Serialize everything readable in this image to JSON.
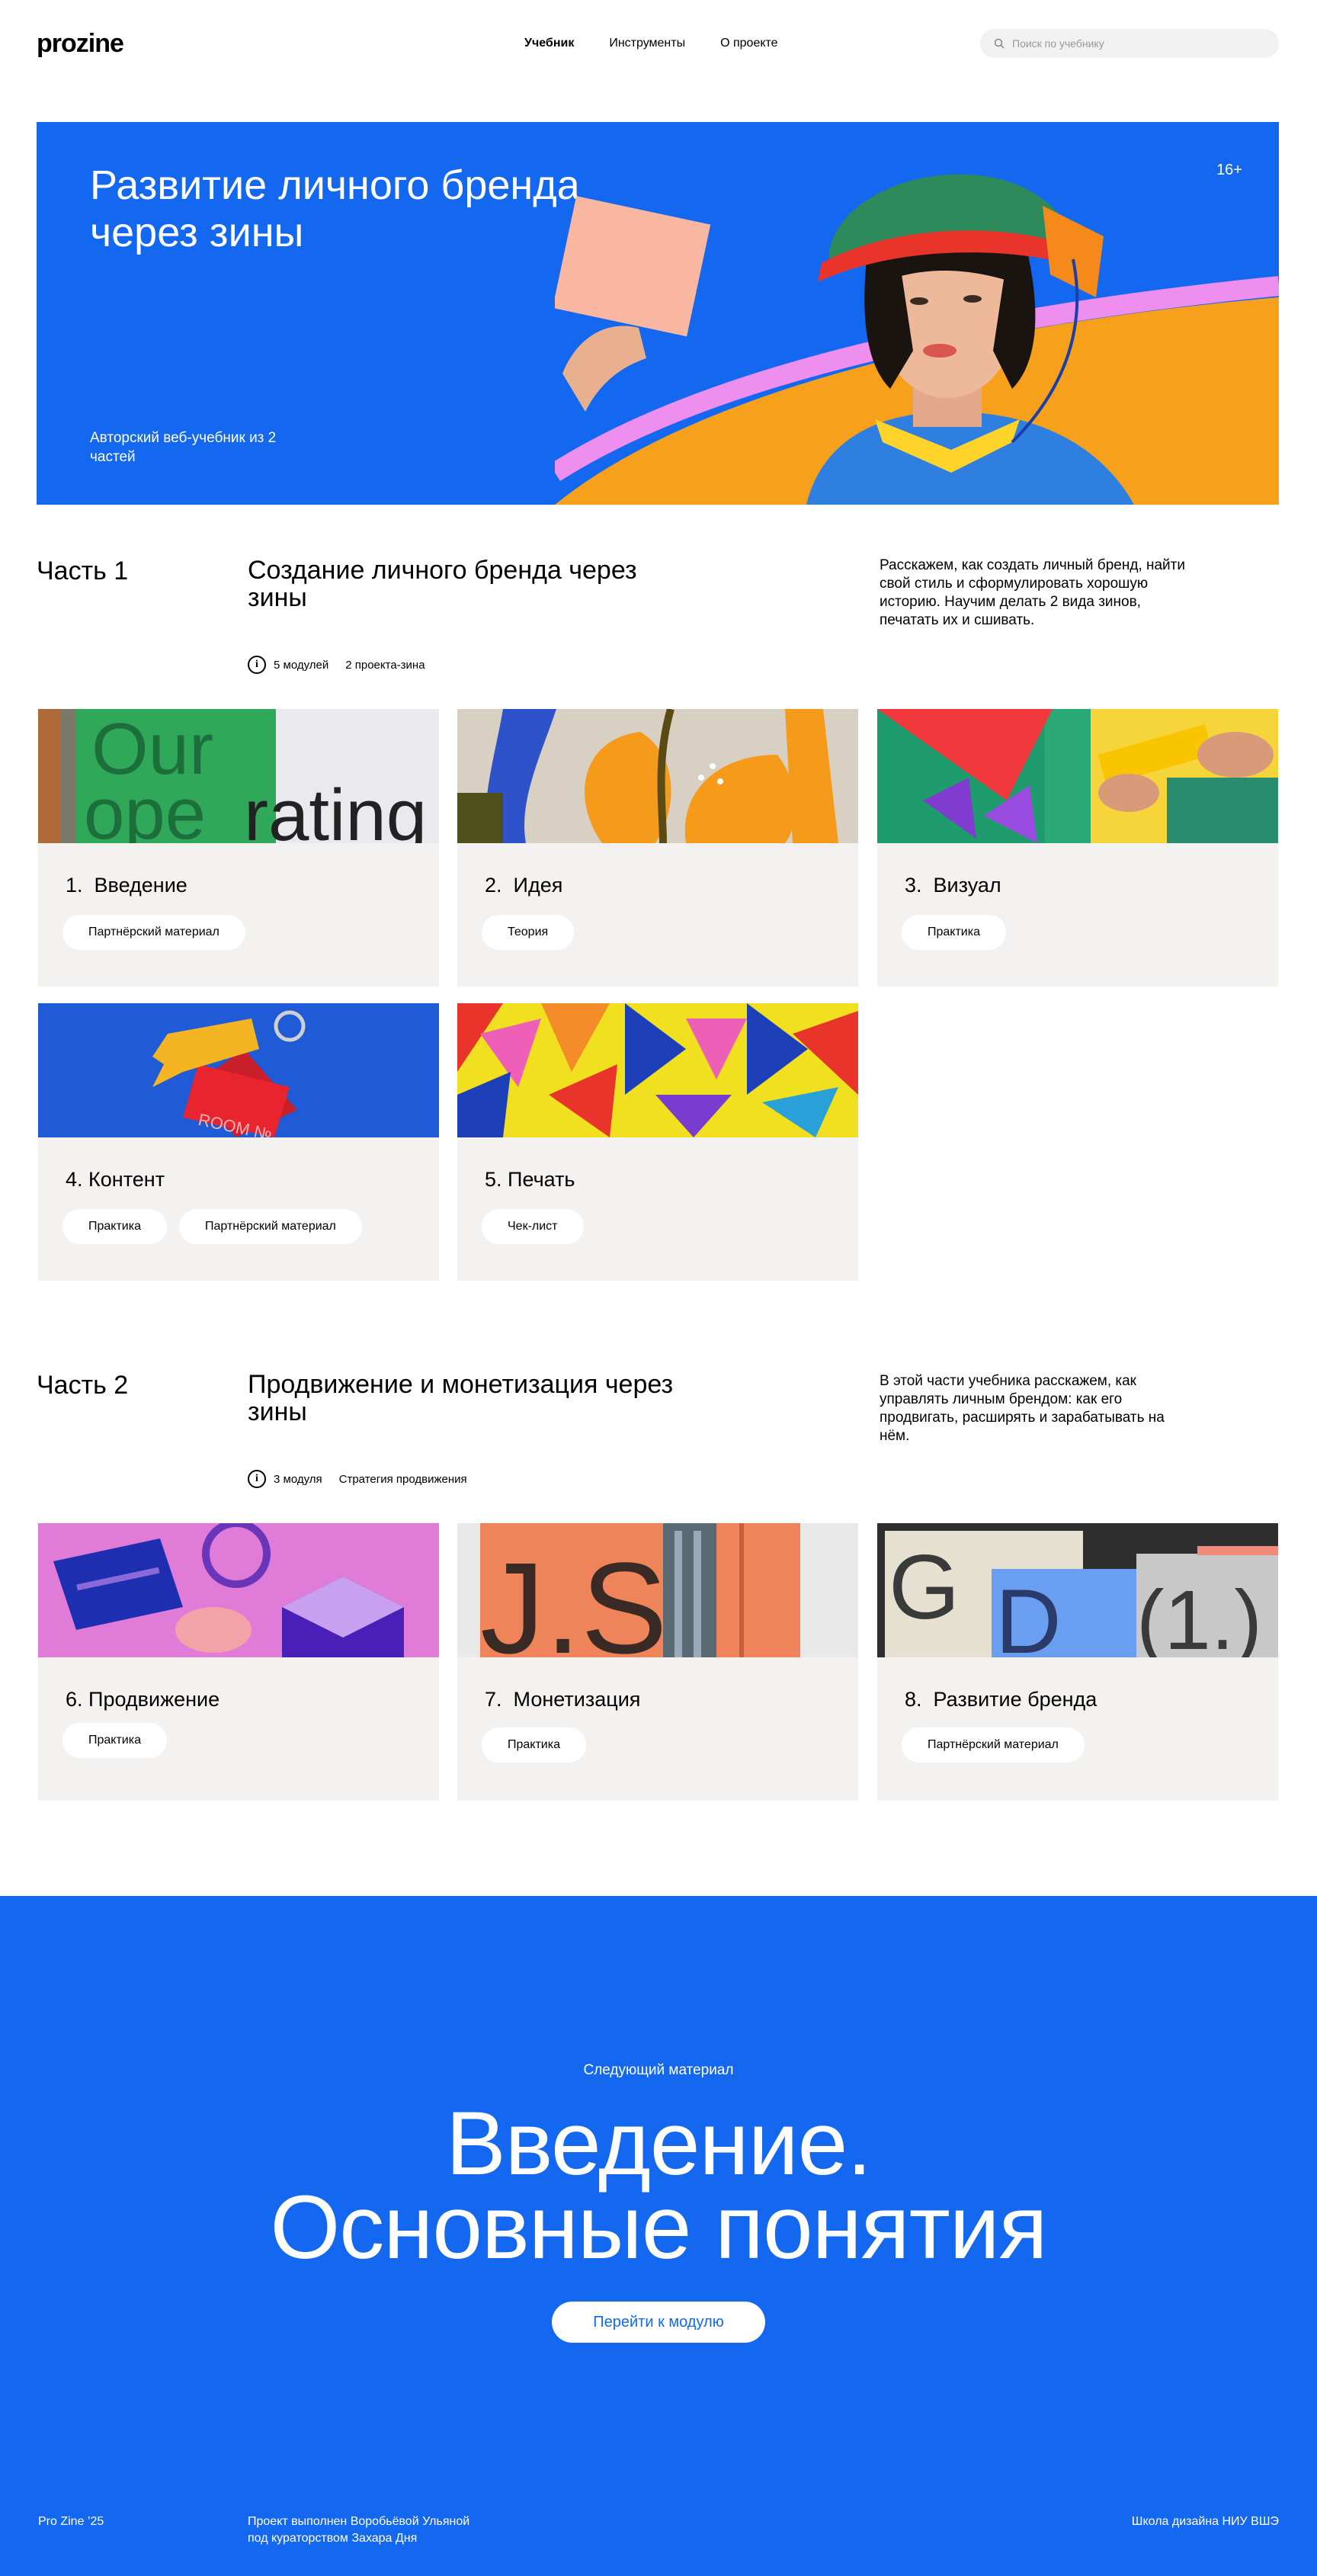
{
  "header": {
    "logo": "prozine",
    "nav": [
      "Учебник",
      "Инструменты",
      "О проекте"
    ],
    "search_placeholder": "Поиск по учебнику"
  },
  "hero": {
    "title": "Развитие личного бренда через зины",
    "subtitle": "Авторский веб-учебник из 2 частей",
    "age": "16+"
  },
  "parts": [
    {
      "label": "Часть 1",
      "title": "Создание личного бренда через зины",
      "description": "Расскажем, как создать личный бренд, найти свой стиль и сформулировать хорошую историю. Научим делать 2 вида зинов, печатать их и сшивать.",
      "meta": [
        "5 модулей",
        "2 проекта-зина"
      ],
      "cards": [
        {
          "num": "1.",
          "title": "Введение",
          "tags": [
            "Партнёрский материал"
          ]
        },
        {
          "num": "2.",
          "title": "Идея",
          "tags": [
            "Теория"
          ]
        },
        {
          "num": "3.",
          "title": "Визуал",
          "tags": [
            "Практика"
          ]
        },
        {
          "num": "4.",
          "title": "Контент",
          "tags": [
            "Практика",
            "Партнёрский материал"
          ]
        },
        {
          "num": "5.",
          "title": "Печать",
          "tags": [
            "Чек-лист"
          ]
        }
      ]
    },
    {
      "label": "Часть 2",
      "title": "Продвижение и монетизация через зины",
      "description": "В этой части учебника расскажем, как управлять личным брендом: как его продвигать, расширять и зарабатывать на нём.",
      "meta": [
        "3 модуля",
        "Стратегия продвижения"
      ],
      "cards": [
        {
          "num": "6.",
          "title": "Продвижение",
          "tags": [
            "Практика"
          ]
        },
        {
          "num": "7.",
          "title": "Монетизация",
          "tags": [
            "Практика"
          ]
        },
        {
          "num": "8.",
          "title": "Развитие бренда",
          "tags": [
            "Партнёрский материал"
          ]
        }
      ]
    }
  ],
  "images": {
    "card1_text": [
      "Our",
      "ope",
      "rating"
    ],
    "card4_text": "ROOM №",
    "card7_text": "J.S",
    "card8_text": [
      "G",
      "D",
      "(1.)"
    ]
  },
  "next": {
    "label": "Следующий материал",
    "title_line1": "Введение.",
    "title_line2": "Основные понятия",
    "button": "Перейти к модулю"
  },
  "footer": {
    "left": "Pro Zine ’25",
    "credits_line1": "Проект выполнен Воробьёвой Ульяной",
    "credits_line2": "под кураторством Захара Дня",
    "right": "Школа дизайна НИУ ВШЭ"
  }
}
